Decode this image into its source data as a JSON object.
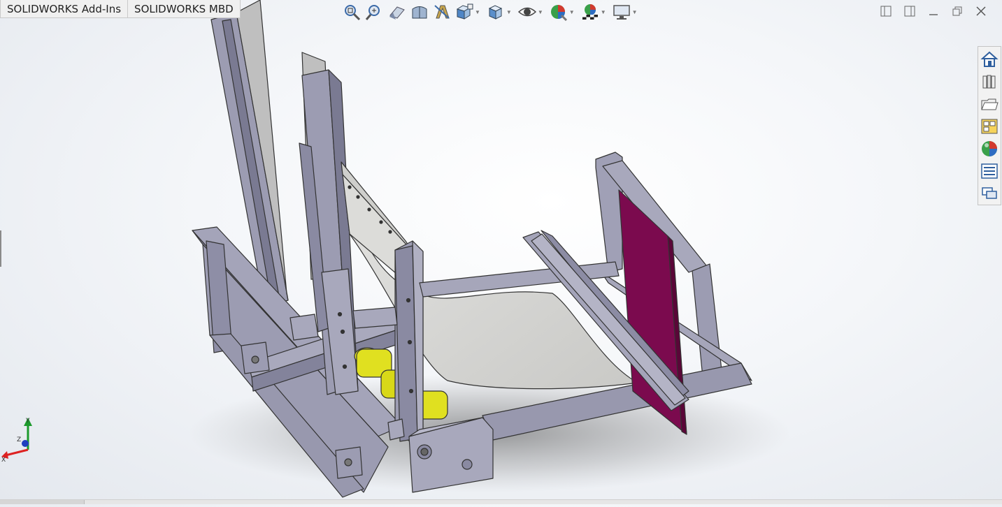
{
  "tabs": [
    {
      "label": "SOLIDWORKS Add-Ins"
    },
    {
      "label": "SOLIDWORKS MBD"
    }
  ],
  "heads_up_toolbar": [
    {
      "icon": "zoom-to-fit-icon"
    },
    {
      "icon": "zoom-to-area-icon"
    },
    {
      "icon": "previous-view-icon"
    },
    {
      "icon": "section-view-icon"
    },
    {
      "icon": "dynamic-annotation-views-icon"
    },
    {
      "icon": "view-orientation-icon"
    },
    {
      "icon": "display-style-icon"
    },
    {
      "icon": "hide-show-items-icon"
    },
    {
      "icon": "edit-appearance-icon"
    },
    {
      "icon": "apply-scene-icon"
    },
    {
      "icon": "view-settings-icon"
    }
  ],
  "window_controls": [
    {
      "icon": "tile-left-icon"
    },
    {
      "icon": "tile-right-icon"
    },
    {
      "icon": "minimize-icon"
    },
    {
      "icon": "restore-icon"
    },
    {
      "icon": "close-icon"
    }
  ],
  "task_pane": [
    {
      "icon": "solidworks-resources-icon"
    },
    {
      "icon": "design-library-icon"
    },
    {
      "icon": "file-explorer-icon"
    },
    {
      "icon": "view-palette-icon"
    },
    {
      "icon": "appearances-scenes-icon"
    },
    {
      "icon": "custom-properties-icon"
    },
    {
      "icon": "forum-icon"
    }
  ],
  "triad": {
    "x": "X",
    "y": "Y",
    "z": "Z"
  },
  "colors": {
    "steel": "#9c9cb2",
    "steel_dark": "#7a7a92",
    "steel_light": "#b9b9cc",
    "sheet": "#d9d9d6",
    "roller": "#e0e020",
    "plate": "#7b0a4e"
  }
}
